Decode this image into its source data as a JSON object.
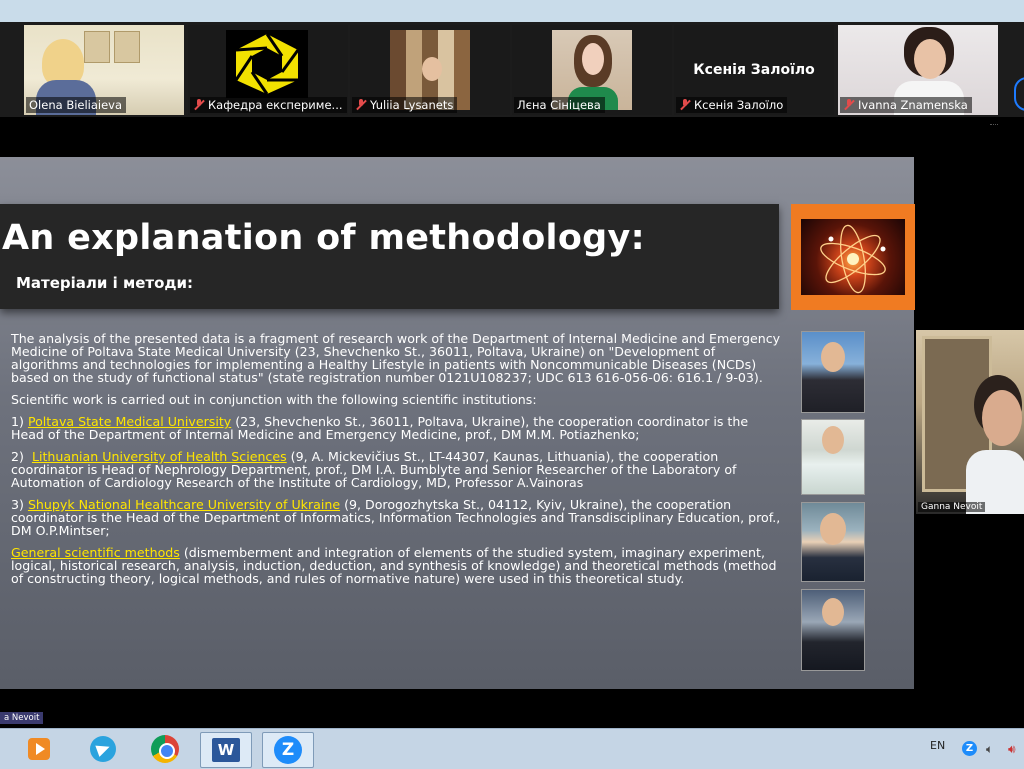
{
  "participants": [
    {
      "name": "Olena Bieliaieva",
      "muted": false,
      "active": true
    },
    {
      "name": "Кафедра експериме...",
      "muted": true
    },
    {
      "name": "Yuliia Lysanets",
      "muted": true
    },
    {
      "name": "Лєна Сініцева",
      "muted": false
    },
    {
      "name": "Ксенія Залоїло",
      "muted": true,
      "display_name": "Ксенія Залоїло"
    },
    {
      "name": "Ivanna Znamenska",
      "muted": true
    }
  ],
  "slide": {
    "title": "An explanation of methodology:",
    "subtitle": "Матеріали і методи:",
    "intro": "The analysis of the presented data is a fragment of research work of the Department of Internal Medicine and Emergency Medicine of Poltava State Medical University (23, Shevchenko St., 36011, Poltava, Ukraine) on \"Development of algorithms and technologies for implementing a Healthy Lifestyle in patients with Noncommunicable Diseases (NCDs) based on the study of functional status\" (state registration number 0121U108237; UDC 613 616-056-06: 616.1 / 9-03).",
    "conjunction": "Scientific work is carried out in conjunction with the following scientific institutions:",
    "items": [
      {
        "prefix": "1) ",
        "highlight": "Poltava State Medical University",
        "rest": " (23, Shevchenko St., 36011, Poltava, Ukraine), the cooperation coordinator is the Head of the Department of Internal Medicine and Emergency Medicine, prof., DM M.M. Potiazhenko;"
      },
      {
        "prefix": "2)  ",
        "highlight": "Lithuanian University of Health Sciences",
        "rest": " (9, A. Mickevičius St., LT-44307, Kaunas, Lithuania), the cooperation coordinator is Head of Nephrology Department, prof., DM I.A. Bumblyte and Senior Researcher of the Laboratory of Automation of Cardiology Research of the Institute of Cardiology, MD, Professor A.Vainoras"
      },
      {
        "prefix": "3) ",
        "highlight": "Shupyk National Healthcare University of Ukraine",
        "rest": " (9, Dorogozhytska St., 04112, Kyiv, Ukraine), the cooperation coordinator is the Head of the Department of Informatics, Information Technologies and Transdisciplinary Education, prof., DM O.P.Mintser;"
      },
      {
        "prefix": "",
        "highlight": "General scientific methods",
        "rest": " (dismemberment and integration of elements of the studied system, imaginary experiment, logical, historical research, analysis, induction, deduction, and synthesis of knowledge) and theoretical methods (method of constructing theory, logical methods, and rules of normative nature) were used in this theoretical study."
      }
    ]
  },
  "speaker_name": "Ganna Nevoit",
  "left_label": "a Nevoit",
  "taskbar": {
    "apps": [
      "media-player-icon",
      "telegram-icon",
      "chrome-icon",
      "word-icon",
      "zoom-icon"
    ],
    "word_letter": "W",
    "zoom_letter": "Z",
    "language": "EN"
  },
  "colors": {
    "highlight": "#ffe600",
    "orange_frame": "#f07b22",
    "active_border": "#8cc84b"
  }
}
